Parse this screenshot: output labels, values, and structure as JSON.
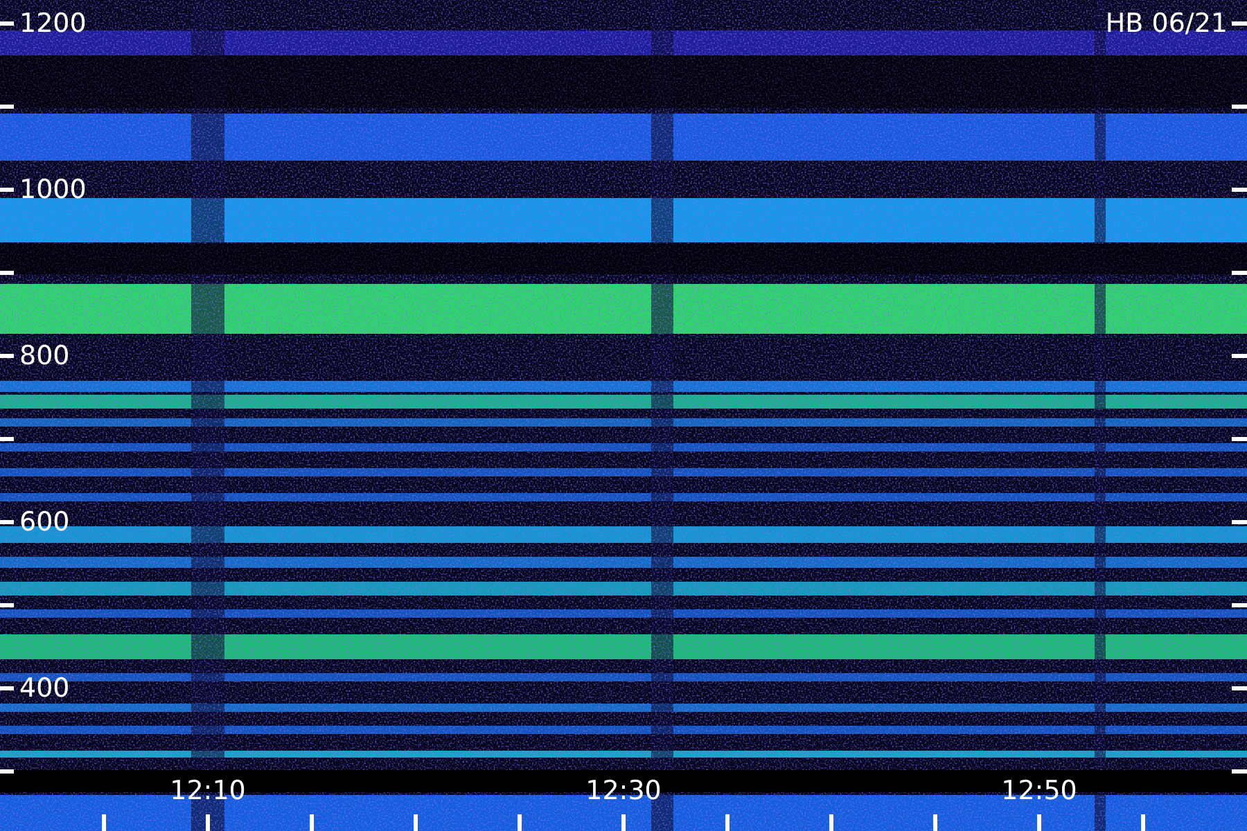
{
  "frequency_labels": [
    "1200",
    "1000",
    "800",
    "600",
    "400"
  ],
  "station_label": "HB 06/21",
  "time_labels": [
    "12:10",
    "12:30",
    "12:50"
  ]
}
